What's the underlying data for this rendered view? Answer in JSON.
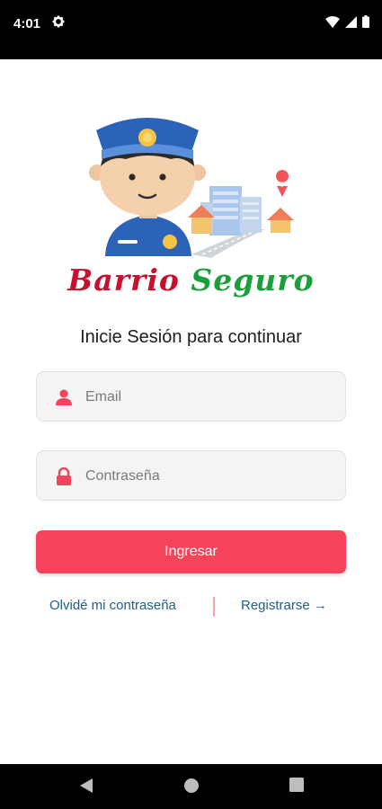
{
  "status_bar": {
    "time": "4:01"
  },
  "brand": {
    "word1": "Barrio",
    "word2": "Seguro"
  },
  "login": {
    "subtitle": "Inicie Sesión para continuar",
    "email_placeholder": "Email",
    "password_placeholder": "Contraseña",
    "submit_label": "Ingresar",
    "forgot_label": "Olvidé mi contraseña",
    "register_label": "Registrarse →"
  },
  "colors": {
    "accent": "#f4435a",
    "link": "#1f5f86",
    "brand_red": "#c8102e",
    "brand_green": "#1aa03a"
  },
  "icons": {
    "status": [
      "gear-icon",
      "wifi-icon",
      "signal-icon",
      "battery-icon"
    ],
    "fields": [
      "user-icon",
      "lock-icon"
    ],
    "nav": [
      "back-icon",
      "home-icon",
      "recents-icon"
    ]
  }
}
